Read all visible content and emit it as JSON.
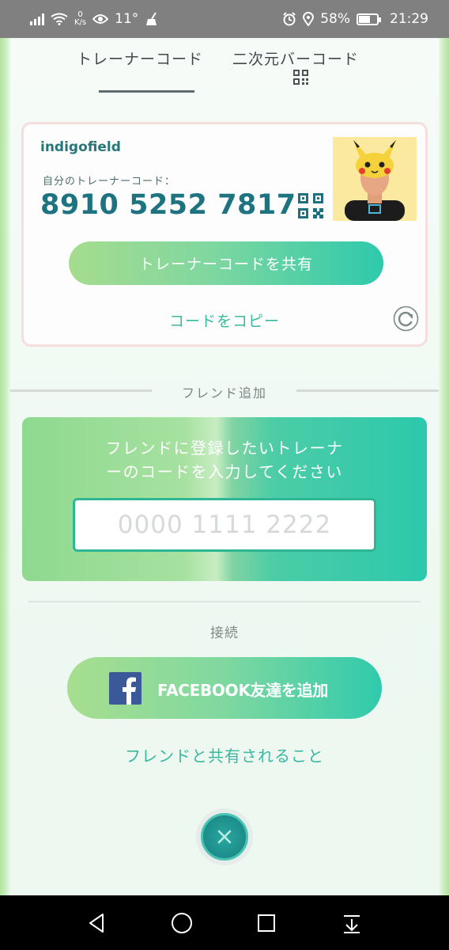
{
  "status_bar": {
    "speed_value": "0",
    "speed_unit": "K/s",
    "temperature": "11°",
    "battery": "58%",
    "time": "21:29"
  },
  "tabs": [
    {
      "label": "トレーナーコード",
      "active": true
    },
    {
      "label": "二次元バーコード",
      "active": false
    }
  ],
  "trainer_card": {
    "username": "indigofield",
    "code_label": "自分のトレーナーコード：",
    "trainer_code": "8910 5252 7817",
    "share_label": "トレーナーコードを共有",
    "copy_label": "コードをコピー"
  },
  "friend_add": {
    "section_title": "フレンド追加",
    "prompt_line1": "フレンドに登録したいトレーナ",
    "prompt_line2": "ーのコードを入力してください",
    "input_placeholder": "0000 1111 2222",
    "input_value": ""
  },
  "connect": {
    "label": "接続",
    "facebook_label": "FACEBOOK友達を追加",
    "shared_info_link": "フレンドと共有されること"
  },
  "colors": {
    "accent": "#2bc9ac",
    "code_text": "#1e7380",
    "link": "#3cb89f"
  },
  "icons": [
    "signal-icon",
    "wifi-icon",
    "eye-icon",
    "broom-icon",
    "alarm-icon",
    "location-icon",
    "battery-icon",
    "qr-code-icon",
    "refresh-icon",
    "facebook-icon",
    "close-icon",
    "back-icon",
    "home-icon",
    "recent-apps-icon",
    "download-icon"
  ]
}
